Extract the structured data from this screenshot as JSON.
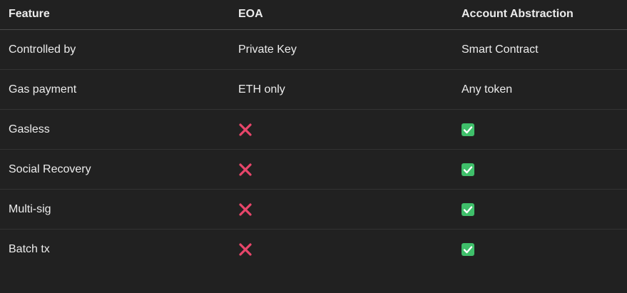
{
  "colors": {
    "background": "#212121",
    "text": "#ececec",
    "cross": "#e8466a",
    "check": "#3fbf6a"
  },
  "table": {
    "headers": [
      "Feature",
      "EOA",
      "Account Abstraction"
    ],
    "rows": [
      {
        "feature": "Controlled by",
        "eoa": "Private Key",
        "aa": "Smart Contract"
      },
      {
        "feature": "Gas payment",
        "eoa": "ETH only",
        "aa": "Any token"
      },
      {
        "feature": "Gasless",
        "eoa_icon": "cross-icon",
        "aa_icon": "check-icon"
      },
      {
        "feature": "Social Recovery",
        "eoa_icon": "cross-icon",
        "aa_icon": "check-icon"
      },
      {
        "feature": "Multi-sig",
        "eoa_icon": "cross-icon",
        "aa_icon": "check-icon"
      },
      {
        "feature": "Batch tx",
        "eoa_icon": "cross-icon",
        "aa_icon": "check-icon"
      }
    ]
  }
}
